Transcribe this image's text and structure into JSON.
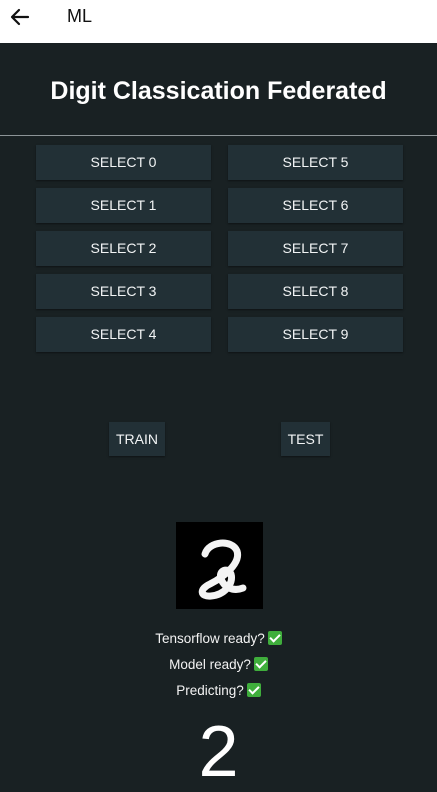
{
  "app_bar": {
    "title": "ML",
    "back_icon": "arrow-left-icon"
  },
  "page_title": "Digit Classication Federated",
  "select_buttons": [
    "SELECT 0",
    "SELECT 5",
    "SELECT 1",
    "SELECT 6",
    "SELECT 2",
    "SELECT 7",
    "SELECT 3",
    "SELECT 8",
    "SELECT 4",
    "SELECT 9"
  ],
  "actions": {
    "train_label": "TRAIN",
    "test_label": "TEST"
  },
  "status": {
    "tensorflow_ready": "Tensorflow ready?",
    "model_ready": "Model ready?",
    "predicting": "Predicting?",
    "check_icon": "check-mark-icon"
  },
  "prediction": "2",
  "colors": {
    "background": "#192123",
    "button": "#223036",
    "check": "#3fae3c"
  }
}
